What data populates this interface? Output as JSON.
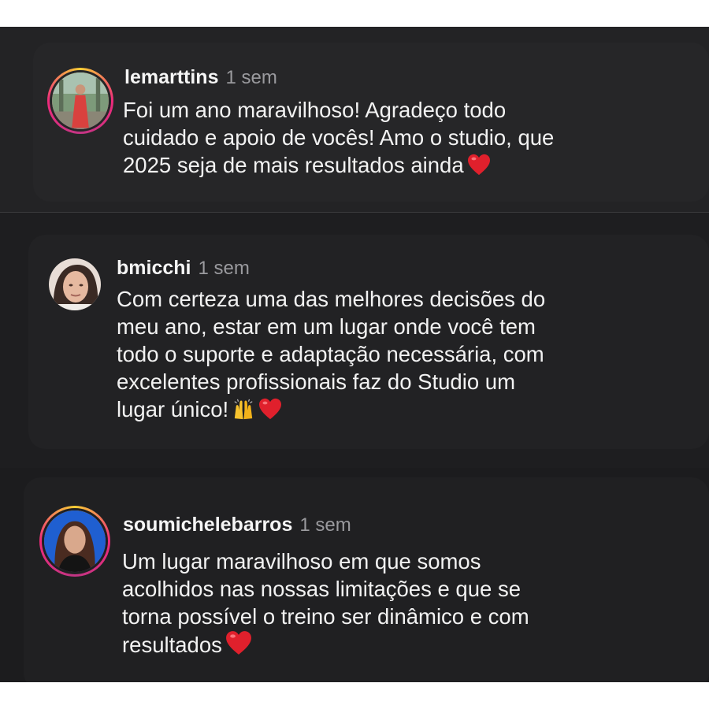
{
  "comments": [
    {
      "username": "lemarttins",
      "time": "1 sem",
      "text": "Foi um ano maravilhoso! Agradeço todo\ncuidado e apoio de vocês! Amo o studio, que\n2025 seja de mais resultados ainda",
      "trailing_emoji": "❤️",
      "avatar_icon": "profile-photo-woman-red-dress",
      "has_story_ring": true
    },
    {
      "username": "bmicchi",
      "time": "1 sem",
      "text": "Com certeza uma das melhores decisões do\nmeu ano, estar em um lugar onde você tem\ntodo o suporte e adaptação necessária, com\nexcelentes profissionais faz do Studio um\nlugar único!",
      "trailing_emoji": "🙌❤️",
      "avatar_icon": "profile-photo-woman-selfie",
      "has_story_ring": false
    },
    {
      "username": "soumichelebarros",
      "time": "1 sem",
      "text": "Um lugar maravilhoso em que somos\nacolhidos nas nossas limitações e que se\ntorna possível o treino ser dinâmico e com\nresultados",
      "trailing_emoji": "❤️",
      "avatar_icon": "profile-photo-woman-blue-background",
      "has_story_ring": true
    }
  ],
  "colors": {
    "background_dark": "#232325",
    "text_primary": "#f2f2f2",
    "text_secondary": "#9a9a9e",
    "heart": "#e0202c",
    "story_ring_start": "#f9ce34",
    "story_ring_end": "#c13584"
  }
}
